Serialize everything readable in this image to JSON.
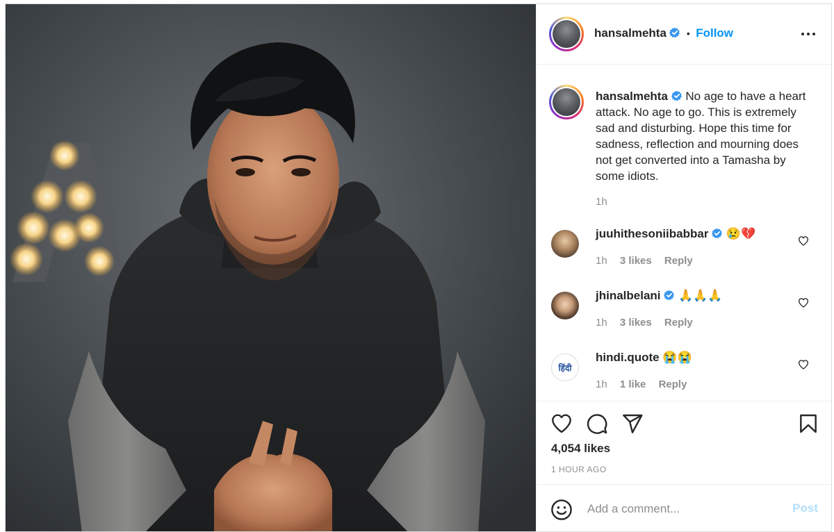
{
  "post": {
    "author": "hansalmehta",
    "follow_label": "Follow",
    "separator": "•",
    "caption": "No age to have a heart attack. No age to go. This is extremely sad and disturbing. Hope this time for sadness, reflection and mourning does not get converted into a Tamasha by some idiots.",
    "caption_time": "1h",
    "likes": "4,054 likes",
    "timestamp": "1 HOUR AGO"
  },
  "comments": [
    {
      "user": "juuhithesoniibabbar",
      "verified": true,
      "text": "😢💔",
      "time": "1h",
      "likes": "3 likes",
      "reply": "Reply"
    },
    {
      "user": "jhinalbelani",
      "verified": true,
      "text": "🙏🙏🙏",
      "time": "1h",
      "likes": "3 likes",
      "reply": "Reply"
    },
    {
      "user": "hindi.quote",
      "verified": false,
      "text": "😭😭",
      "time": "1h",
      "likes": "1 like",
      "reply": "Reply",
      "avatar_text": "हिंदी"
    }
  ],
  "composer": {
    "placeholder": "Add a comment...",
    "post_label": "Post"
  },
  "icons": {
    "like": "heart-icon",
    "comment": "comment-icon",
    "share": "share-icon",
    "save": "bookmark-icon",
    "emoji": "emoji-icon",
    "more": "more-icon",
    "verified": "verified-badge-icon"
  },
  "colors": {
    "follow": "#0095f6",
    "verified": "#3897f0",
    "muted": "#8e8e8e",
    "post_disabled": "#b2dffc"
  }
}
